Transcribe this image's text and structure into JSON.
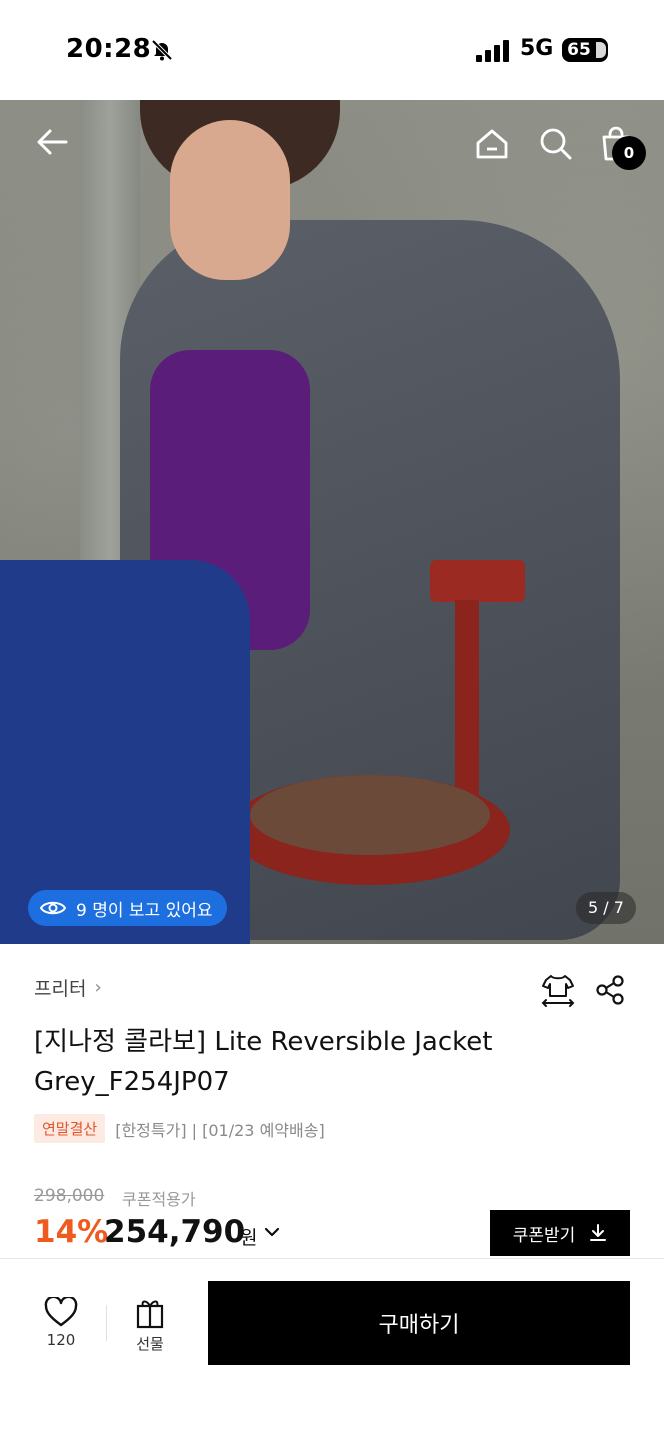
{
  "status_bar": {
    "time": "20:28",
    "network": "5G",
    "battery": "65"
  },
  "hero": {
    "viewers_text": "9 명이 보고 있어요",
    "image_counter": "5 / 7",
    "cart_count": "0",
    "icons": [
      "back-arrow-icon",
      "home-icon",
      "search-icon",
      "shopping-bag-icon"
    ]
  },
  "product": {
    "brand": "프리터",
    "title": "[지나정 콜라보] Lite Reversible Jacket Grey_F254JP07",
    "tag_sale": "연말결산",
    "tag_info": "[한정특가] | [01/23 예약배송]",
    "original_price": "298,000",
    "coupon_price_label": "쿠폰적용가",
    "discount": "14%",
    "price": "254,790",
    "currency": "원",
    "coupon_button": "쿠폰받기"
  },
  "bottom_bar": {
    "like_count": "120",
    "gift_label": "선물",
    "buy_label": "구매하기"
  },
  "colors": {
    "viewers_pill": "#1d6fe0",
    "discount": "#ef5a1d",
    "sale_tag_bg": "#fdeae3",
    "sale_tag_text": "#e2562b",
    "buy_button": "#000000"
  }
}
